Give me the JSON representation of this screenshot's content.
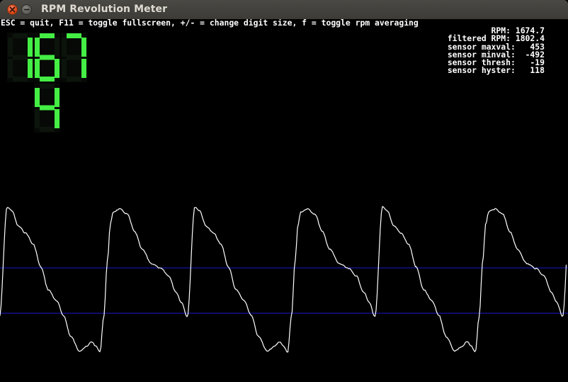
{
  "window": {
    "title": "RPM Revolution Meter",
    "close_icon": "close-icon",
    "minimize_icon": "minimize-icon"
  },
  "help_text": "ESC = quit, F11 = toggle fullscreen, +/- = change digit size, f = toggle rpm averaging",
  "stats": [
    {
      "label": "RPM:",
      "value": "1674.7"
    },
    {
      "label": "filtered RPM:",
      "value": "1802.4"
    },
    {
      "label": "sensor maxval:",
      "value": "453"
    },
    {
      "label": "sensor minval:",
      "value": "-492"
    },
    {
      "label": "sensor thresh:",
      "value": "-19"
    },
    {
      "label": "sensor hyster:",
      "value": "118"
    }
  ],
  "display": {
    "digits": [
      "1",
      "6",
      "7",
      "4"
    ],
    "lit_color": "#44ee44",
    "unlit_color": "#0c140c"
  },
  "colors": {
    "background": "#000000",
    "waveform": "#ffffff",
    "threshold_lines": "#1a1acc",
    "text": "#ffffff",
    "close_button": "#dd4814"
  }
}
